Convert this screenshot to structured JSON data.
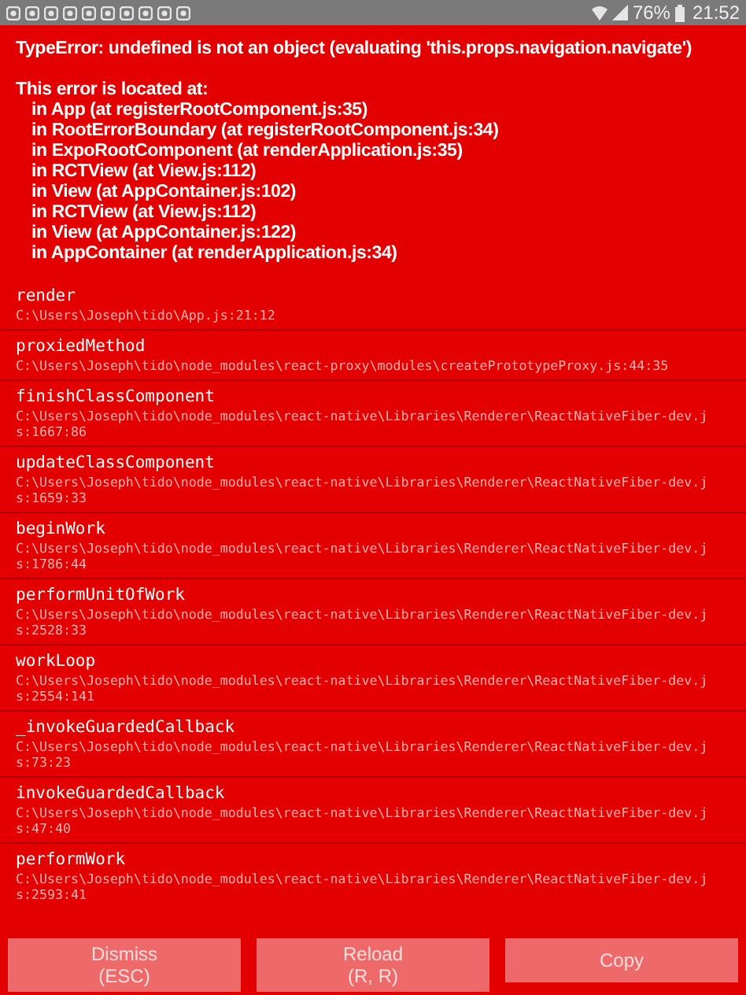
{
  "status_bar": {
    "battery": "76%",
    "time": "21:52"
  },
  "error": {
    "message": "TypeError: undefined is not an object (evaluating 'this.props.navigation.navigate')",
    "location_heading": "This error is located at:",
    "component_stack": [
      "in App (at registerRootComponent.js:35)",
      "in RootErrorBoundary (at registerRootComponent.js:34)",
      "in ExpoRootComponent (at renderApplication.js:35)",
      "in RCTView (at View.js:112)",
      "in View (at AppContainer.js:102)",
      "in RCTView (at View.js:112)",
      "in View (at AppContainer.js:122)",
      "in AppContainer (at renderApplication.js:34)"
    ]
  },
  "stack": [
    {
      "method": "render",
      "file": "C:\\Users\\Joseph\\tido\\App.js:21:12"
    },
    {
      "method": "proxiedMethod",
      "file": "C:\\Users\\Joseph\\tido\\node_modules\\react-proxy\\modules\\createPrototypeProxy.js:44:35"
    },
    {
      "method": "finishClassComponent",
      "file": "C:\\Users\\Joseph\\tido\\node_modules\\react-native\\Libraries\\Renderer\\ReactNativeFiber-dev.js:1667:86"
    },
    {
      "method": "updateClassComponent",
      "file": "C:\\Users\\Joseph\\tido\\node_modules\\react-native\\Libraries\\Renderer\\ReactNativeFiber-dev.js:1659:33"
    },
    {
      "method": "beginWork",
      "file": "C:\\Users\\Joseph\\tido\\node_modules\\react-native\\Libraries\\Renderer\\ReactNativeFiber-dev.js:1786:44"
    },
    {
      "method": "performUnitOfWork",
      "file": "C:\\Users\\Joseph\\tido\\node_modules\\react-native\\Libraries\\Renderer\\ReactNativeFiber-dev.js:2528:33"
    },
    {
      "method": "workLoop",
      "file": "C:\\Users\\Joseph\\tido\\node_modules\\react-native\\Libraries\\Renderer\\ReactNativeFiber-dev.js:2554:141"
    },
    {
      "method": "_invokeGuardedCallback",
      "file": "C:\\Users\\Joseph\\tido\\node_modules\\react-native\\Libraries\\Renderer\\ReactNativeFiber-dev.js:73:23"
    },
    {
      "method": "invokeGuardedCallback",
      "file": "C:\\Users\\Joseph\\tido\\node_modules\\react-native\\Libraries\\Renderer\\ReactNativeFiber-dev.js:47:40"
    },
    {
      "method": "performWork",
      "file": "C:\\Users\\Joseph\\tido\\node_modules\\react-native\\Libraries\\Renderer\\ReactNativeFiber-dev.js:2593:41"
    }
  ],
  "buttons": [
    {
      "label": "Dismiss",
      "shortcut": "(ESC)",
      "disabled": true
    },
    {
      "label": "Reload",
      "shortcut": "(R, R)",
      "disabled": true
    },
    {
      "label": "Copy",
      "disabled": true
    }
  ]
}
